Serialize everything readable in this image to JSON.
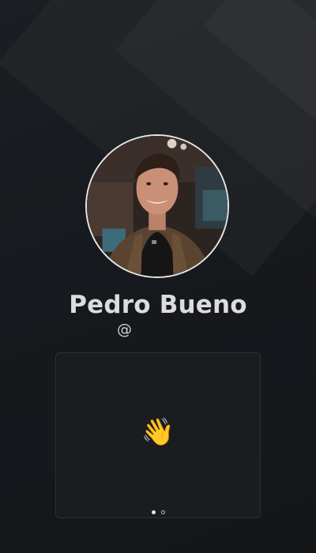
{
  "profile": {
    "name": "Pedro Bueno",
    "handle": "@"
  },
  "card": {
    "emoji": "👋",
    "pagination": {
      "total": 2,
      "active": 1
    }
  },
  "icons": {
    "wave": "waving-hand-icon"
  },
  "colors": {
    "background": "#15181c",
    "card_border": "#2c3035",
    "name_text": "#dcdcdc",
    "avatar_border": "#e6e6e6"
  }
}
